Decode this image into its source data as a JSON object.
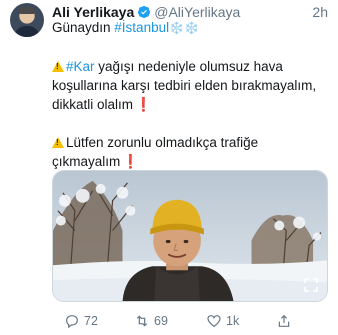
{
  "user": {
    "display_name": "Ali Yerlikaya",
    "handle": "@AliYerlikaya",
    "timestamp": "2h",
    "verified": true
  },
  "tweet": {
    "line1_text": "Günaydın ",
    "line1_hashtag": "#İstanbul",
    "line1_emoji": "❄️❄️",
    "para1_hashtag": "#Kar",
    "para1_text": " yağışı nedeniyle olumsuz hava koşullarına karşı tedbiri elden bırakmayalım, dikkatli olalım",
    "para2_text": "Lütfen zorunlu olmadıkça trafiğe çıkmayalım"
  },
  "media": {
    "type": "photo",
    "description_icon": "expand-icon"
  },
  "actions": {
    "replies": "72",
    "retweets": "69",
    "likes": "1k"
  },
  "colors": {
    "accent": "#1b95e0",
    "muted": "#657786",
    "warning": "#f5c000",
    "exclamation": "#dd2e44"
  }
}
